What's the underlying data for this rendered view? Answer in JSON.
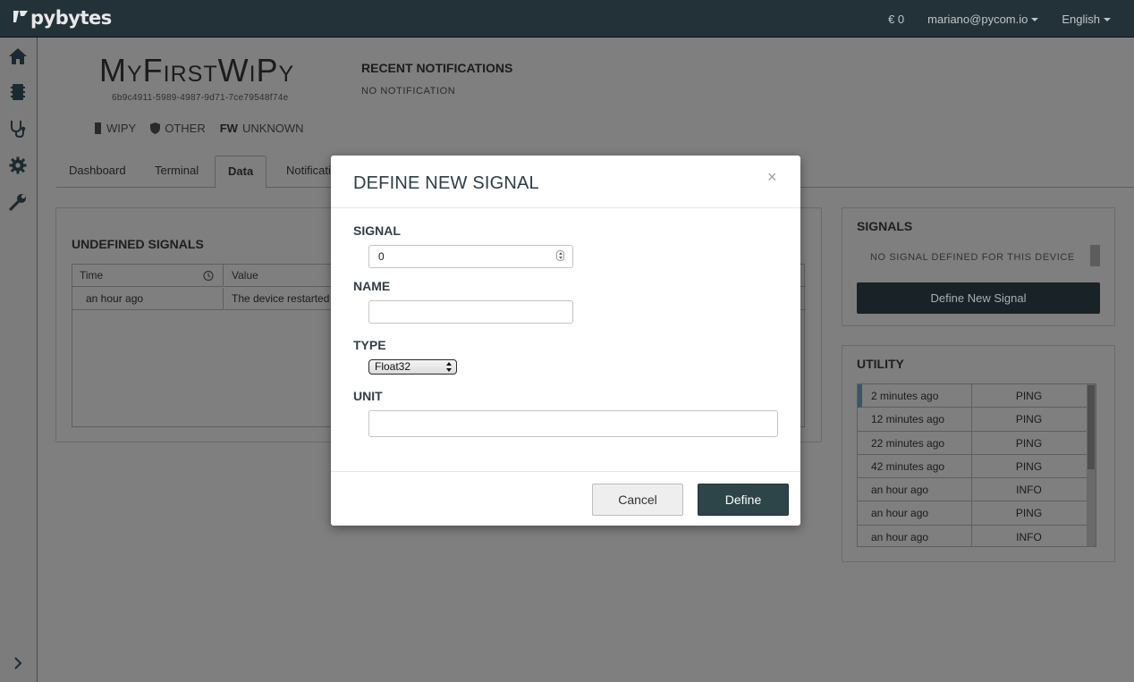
{
  "topbar": {
    "logo_text": "pybytes",
    "balance": "€ 0",
    "user_email": "mariano@pycom.io",
    "language": "English"
  },
  "sidebar": {
    "icons": [
      "home-icon",
      "device-chip-icon",
      "stethoscope-icon",
      "gear-icon",
      "wrench-icon",
      "chevron-right-icon"
    ]
  },
  "device": {
    "name": "MyFirstWiPy",
    "id": "6b9c4911-5989-4987-9d71-7ce79548f74e",
    "badges": {
      "type": "WIPY",
      "network": "OTHER",
      "fw_label": "FW",
      "fw_value": "UNKNOWN"
    }
  },
  "notifications": {
    "title": "RECENT NOTIFICATIONS",
    "empty_text": "NO NOTIFICATION"
  },
  "tabs": [
    {
      "label": "Dashboard"
    },
    {
      "label": "Terminal"
    },
    {
      "label": "Data"
    },
    {
      "label": "Notificati"
    }
  ],
  "undefined_signals": {
    "title": "UNDEFINED SIGNALS",
    "columns": [
      "Time",
      "Value"
    ],
    "rows": [
      {
        "time": "an hour ago",
        "value": "The device restarted"
      }
    ]
  },
  "signals_panel": {
    "title": "SIGNALS",
    "empty_text": "NO SIGNAL DEFINED FOR THIS DEVICE",
    "button_label": "Define New Signal"
  },
  "utility_panel": {
    "title": "UTILITY",
    "rows": [
      {
        "time": "2 minutes ago",
        "type": "PING"
      },
      {
        "time": "12 minutes ago",
        "type": "PING"
      },
      {
        "time": "22 minutes ago",
        "type": "PING"
      },
      {
        "time": "42 minutes ago",
        "type": "PING"
      },
      {
        "time": "an hour ago",
        "type": "INFO"
      },
      {
        "time": "an hour ago",
        "type": "PING"
      },
      {
        "time": "an hour ago",
        "type": "INFO"
      }
    ]
  },
  "modal": {
    "title": "DEFINE NEW SIGNAL",
    "close_label": "×",
    "signal_label": "SIGNAL",
    "signal_value": "0",
    "name_label": "NAME",
    "name_value": "",
    "type_label": "TYPE",
    "type_value": "Float32",
    "unit_label": "UNIT",
    "unit_value": "",
    "cancel_label": "Cancel",
    "define_label": "Define"
  },
  "colors": {
    "topbar": "#233238",
    "primary_button": "#2d4549",
    "overlay_gray": "#7f7f7f"
  }
}
